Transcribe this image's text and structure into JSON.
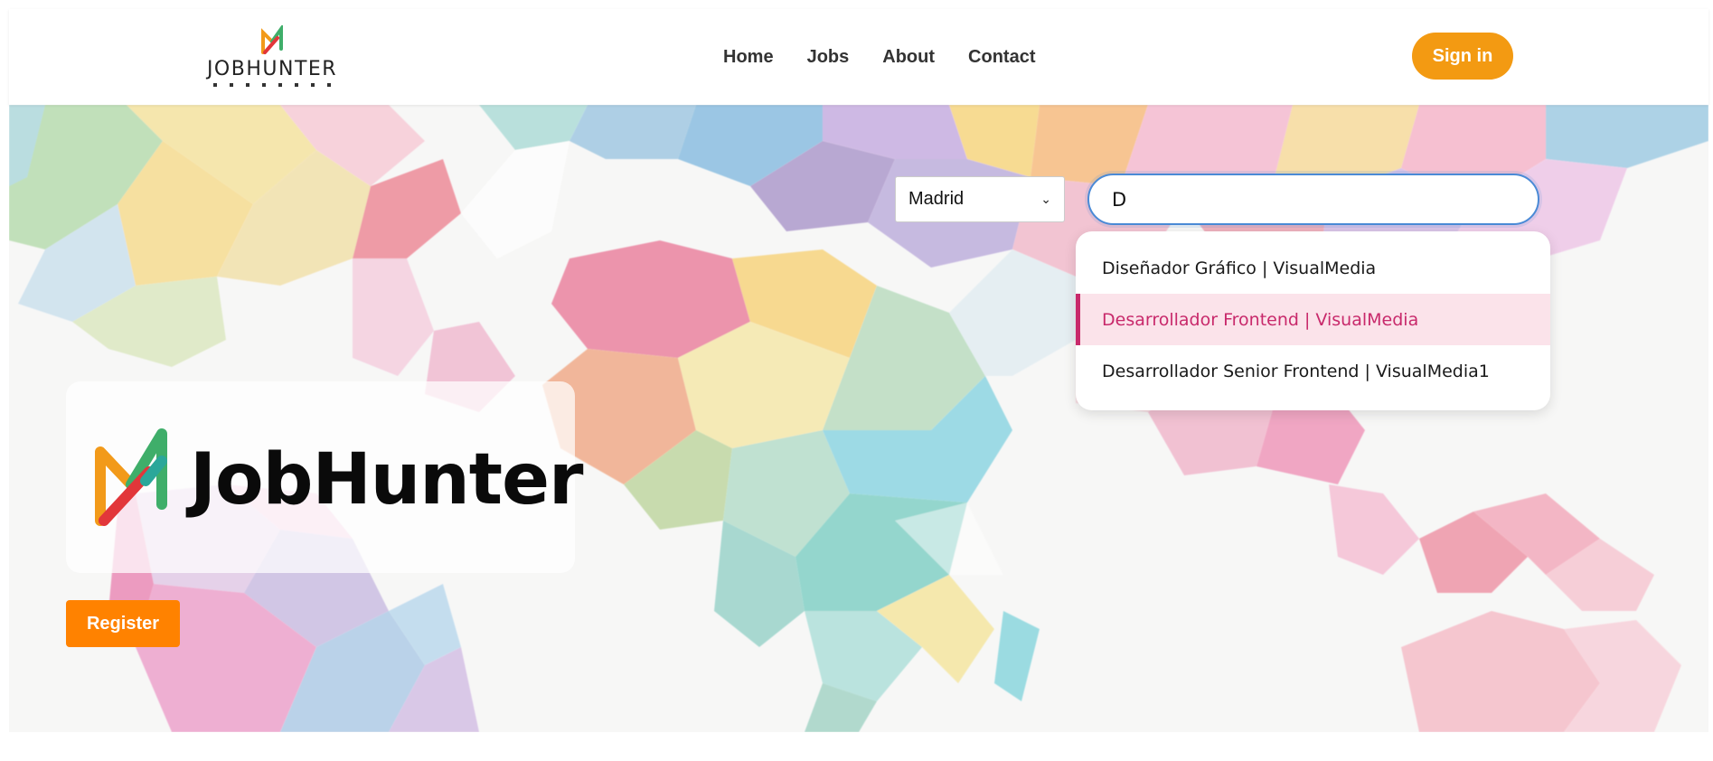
{
  "header": {
    "logo_text": "JOBHUNTER",
    "nav": [
      "Home",
      "Jobs",
      "About",
      "Contact"
    ],
    "signin_label": "Sign in",
    "accent_color": "#f39a12"
  },
  "hero": {
    "brand_name": "JobHunter",
    "register_label": "Register",
    "register_color": "#ff8200"
  },
  "search": {
    "city": "Madrid",
    "query": "D",
    "suggestions": [
      "Diseñador Gráfico | VisualMedia",
      "Desarrollador Frontend | VisualMedia",
      "Desarrollador Senior Frontend | VisualMedia1"
    ],
    "highlighted_index": 1,
    "highlight_color": "#c8296b"
  },
  "icons": {
    "logo": "jobhunter-logo-icon",
    "select_chevron": "chevron-down-icon"
  }
}
